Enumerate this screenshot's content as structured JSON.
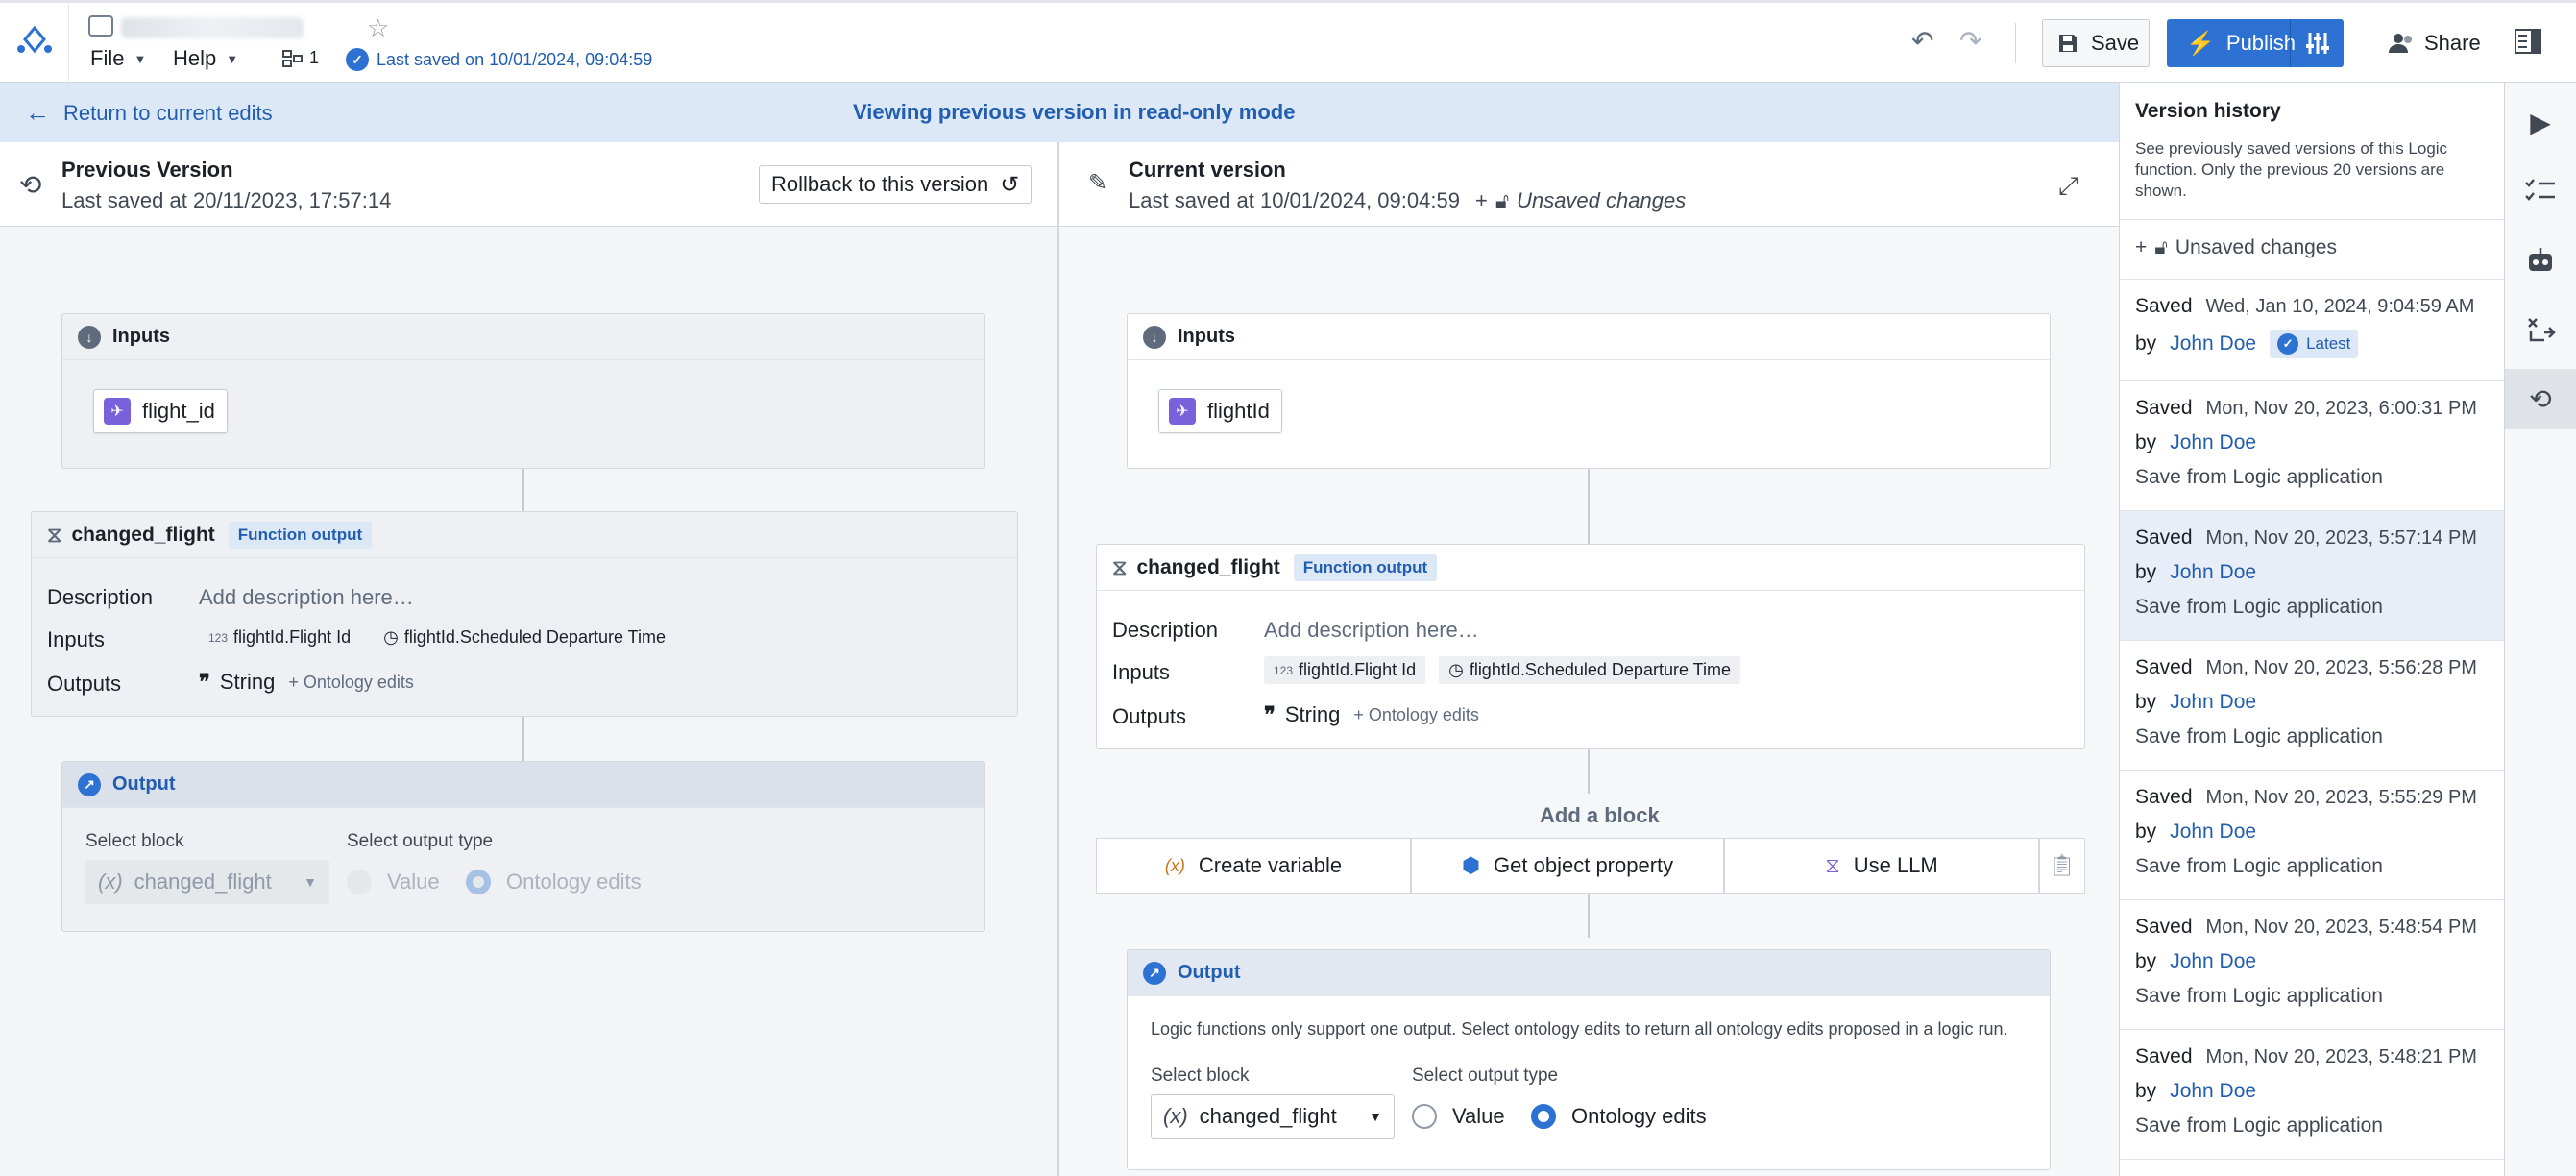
{
  "topbar": {
    "file_menu": "File",
    "help_menu": "Help",
    "branch_count": "1",
    "last_saved": "Last saved on 10/01/2024, 09:04:59",
    "save_label": "Save",
    "publish_label": "Publish",
    "share_label": "Share"
  },
  "banner": {
    "return_label": "Return to current edits",
    "mode_text": "Viewing previous version in read-only mode"
  },
  "previous": {
    "title": "Previous Version",
    "subtitle": "Last saved at 20/11/2023, 17:57:14",
    "rollback_label": "Rollback to this version",
    "inputs_title": "Inputs",
    "input_chip": "flight_id",
    "fn_name": "changed_flight",
    "fn_tag": "Function output",
    "desc_label": "Description",
    "desc_placeholder": "Add description here…",
    "inputs_label": "Inputs",
    "input_pill_1": "flightId.Flight Id",
    "input_pill_2": "flightId.Scheduled Departure Time",
    "outputs_label": "Outputs",
    "output_type": "String",
    "output_extra": "+ Ontology edits",
    "output_title": "Output",
    "select_block_label": "Select block",
    "select_block_value": "changed_flight",
    "select_type_label": "Select output type",
    "radio_value": "Value",
    "radio_edits": "Ontology edits"
  },
  "current": {
    "title": "Current version",
    "subtitle": "Last saved at 10/01/2024, 09:04:59",
    "unsaved": "Unsaved changes",
    "inputs_title": "Inputs",
    "input_chip": "flightId",
    "fn_name": "changed_flight",
    "fn_tag": "Function output",
    "desc_label": "Description",
    "desc_placeholder": "Add description here…",
    "inputs_label": "Inputs",
    "input_pill_1": "flightId.Flight Id",
    "input_pill_2": "flightId.Scheduled Departure Time",
    "outputs_label": "Outputs",
    "output_type": "String",
    "output_extra": "+ Ontology edits",
    "add_block_title": "Add a block",
    "add_create_variable": "Create variable",
    "add_get_property": "Get object property",
    "add_use_llm": "Use LLM",
    "output_title": "Output",
    "output_note": "Logic functions only support one output. Select ontology edits to return all ontology edits proposed in a logic run.",
    "select_block_label": "Select block",
    "select_block_value": "changed_flight",
    "select_type_label": "Select output type",
    "radio_value": "Value",
    "radio_edits": "Ontology edits"
  },
  "version_history": {
    "title": "Version history",
    "description": "See previously saved versions of this Logic function. Only the previous 20 versions are shown.",
    "unsaved": "Unsaved changes",
    "saved_word": "Saved",
    "by_word": "by",
    "latest_label": "Latest",
    "items": [
      {
        "date": "Wed, Jan 10, 2024, 9:04:59 AM",
        "author": "John Doe",
        "message": ""
      },
      {
        "date": "Mon, Nov 20, 2023, 6:00:31 PM",
        "author": "John Doe",
        "message": "Save from Logic application"
      },
      {
        "date": "Mon, Nov 20, 2023, 5:57:14 PM",
        "author": "John Doe",
        "message": "Save from Logic application"
      },
      {
        "date": "Mon, Nov 20, 2023, 5:56:28 PM",
        "author": "John Doe",
        "message": "Save from Logic application"
      },
      {
        "date": "Mon, Nov 20, 2023, 5:55:29 PM",
        "author": "John Doe",
        "message": "Save from Logic application"
      },
      {
        "date": "Mon, Nov 20, 2023, 5:48:54 PM",
        "author": "John Doe",
        "message": "Save from Logic application"
      },
      {
        "date": "Mon, Nov 20, 2023, 5:48:21 PM",
        "author": "John Doe",
        "message": "Save from Logic application"
      }
    ]
  },
  "colors": {
    "accent": "#2d72d2",
    "banner_bg": "#dce8f6",
    "selected_row": "#e8eef7"
  }
}
